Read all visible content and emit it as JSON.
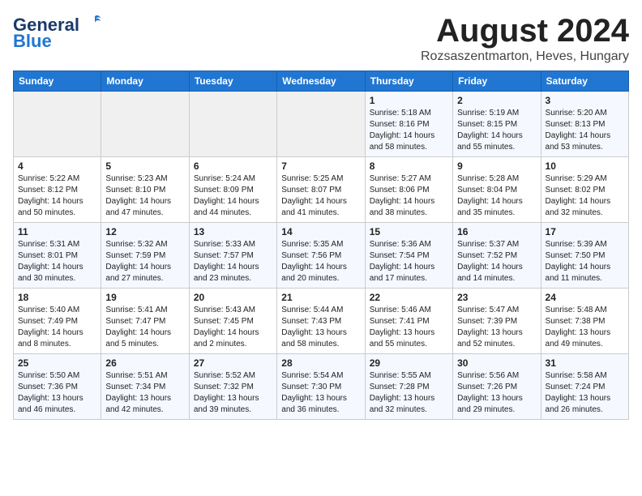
{
  "header": {
    "logo_line1": "General",
    "logo_line2": "Blue",
    "month": "August 2024",
    "location": "Rozsaszentmarton, Heves, Hungary"
  },
  "weekdays": [
    "Sunday",
    "Monday",
    "Tuesday",
    "Wednesday",
    "Thursday",
    "Friday",
    "Saturday"
  ],
  "weeks": [
    [
      {
        "day": "",
        "info": ""
      },
      {
        "day": "",
        "info": ""
      },
      {
        "day": "",
        "info": ""
      },
      {
        "day": "",
        "info": ""
      },
      {
        "day": "1",
        "info": "Sunrise: 5:18 AM\nSunset: 8:16 PM\nDaylight: 14 hours\nand 58 minutes."
      },
      {
        "day": "2",
        "info": "Sunrise: 5:19 AM\nSunset: 8:15 PM\nDaylight: 14 hours\nand 55 minutes."
      },
      {
        "day": "3",
        "info": "Sunrise: 5:20 AM\nSunset: 8:13 PM\nDaylight: 14 hours\nand 53 minutes."
      }
    ],
    [
      {
        "day": "4",
        "info": "Sunrise: 5:22 AM\nSunset: 8:12 PM\nDaylight: 14 hours\nand 50 minutes."
      },
      {
        "day": "5",
        "info": "Sunrise: 5:23 AM\nSunset: 8:10 PM\nDaylight: 14 hours\nand 47 minutes."
      },
      {
        "day": "6",
        "info": "Sunrise: 5:24 AM\nSunset: 8:09 PM\nDaylight: 14 hours\nand 44 minutes."
      },
      {
        "day": "7",
        "info": "Sunrise: 5:25 AM\nSunset: 8:07 PM\nDaylight: 14 hours\nand 41 minutes."
      },
      {
        "day": "8",
        "info": "Sunrise: 5:27 AM\nSunset: 8:06 PM\nDaylight: 14 hours\nand 38 minutes."
      },
      {
        "day": "9",
        "info": "Sunrise: 5:28 AM\nSunset: 8:04 PM\nDaylight: 14 hours\nand 35 minutes."
      },
      {
        "day": "10",
        "info": "Sunrise: 5:29 AM\nSunset: 8:02 PM\nDaylight: 14 hours\nand 32 minutes."
      }
    ],
    [
      {
        "day": "11",
        "info": "Sunrise: 5:31 AM\nSunset: 8:01 PM\nDaylight: 14 hours\nand 30 minutes."
      },
      {
        "day": "12",
        "info": "Sunrise: 5:32 AM\nSunset: 7:59 PM\nDaylight: 14 hours\nand 27 minutes."
      },
      {
        "day": "13",
        "info": "Sunrise: 5:33 AM\nSunset: 7:57 PM\nDaylight: 14 hours\nand 23 minutes."
      },
      {
        "day": "14",
        "info": "Sunrise: 5:35 AM\nSunset: 7:56 PM\nDaylight: 14 hours\nand 20 minutes."
      },
      {
        "day": "15",
        "info": "Sunrise: 5:36 AM\nSunset: 7:54 PM\nDaylight: 14 hours\nand 17 minutes."
      },
      {
        "day": "16",
        "info": "Sunrise: 5:37 AM\nSunset: 7:52 PM\nDaylight: 14 hours\nand 14 minutes."
      },
      {
        "day": "17",
        "info": "Sunrise: 5:39 AM\nSunset: 7:50 PM\nDaylight: 14 hours\nand 11 minutes."
      }
    ],
    [
      {
        "day": "18",
        "info": "Sunrise: 5:40 AM\nSunset: 7:49 PM\nDaylight: 14 hours\nand 8 minutes."
      },
      {
        "day": "19",
        "info": "Sunrise: 5:41 AM\nSunset: 7:47 PM\nDaylight: 14 hours\nand 5 minutes."
      },
      {
        "day": "20",
        "info": "Sunrise: 5:43 AM\nSunset: 7:45 PM\nDaylight: 14 hours\nand 2 minutes."
      },
      {
        "day": "21",
        "info": "Sunrise: 5:44 AM\nSunset: 7:43 PM\nDaylight: 13 hours\nand 58 minutes."
      },
      {
        "day": "22",
        "info": "Sunrise: 5:46 AM\nSunset: 7:41 PM\nDaylight: 13 hours\nand 55 minutes."
      },
      {
        "day": "23",
        "info": "Sunrise: 5:47 AM\nSunset: 7:39 PM\nDaylight: 13 hours\nand 52 minutes."
      },
      {
        "day": "24",
        "info": "Sunrise: 5:48 AM\nSunset: 7:38 PM\nDaylight: 13 hours\nand 49 minutes."
      }
    ],
    [
      {
        "day": "25",
        "info": "Sunrise: 5:50 AM\nSunset: 7:36 PM\nDaylight: 13 hours\nand 46 minutes."
      },
      {
        "day": "26",
        "info": "Sunrise: 5:51 AM\nSunset: 7:34 PM\nDaylight: 13 hours\nand 42 minutes."
      },
      {
        "day": "27",
        "info": "Sunrise: 5:52 AM\nSunset: 7:32 PM\nDaylight: 13 hours\nand 39 minutes."
      },
      {
        "day": "28",
        "info": "Sunrise: 5:54 AM\nSunset: 7:30 PM\nDaylight: 13 hours\nand 36 minutes."
      },
      {
        "day": "29",
        "info": "Sunrise: 5:55 AM\nSunset: 7:28 PM\nDaylight: 13 hours\nand 32 minutes."
      },
      {
        "day": "30",
        "info": "Sunrise: 5:56 AM\nSunset: 7:26 PM\nDaylight: 13 hours\nand 29 minutes."
      },
      {
        "day": "31",
        "info": "Sunrise: 5:58 AM\nSunset: 7:24 PM\nDaylight: 13 hours\nand 26 minutes."
      }
    ]
  ]
}
